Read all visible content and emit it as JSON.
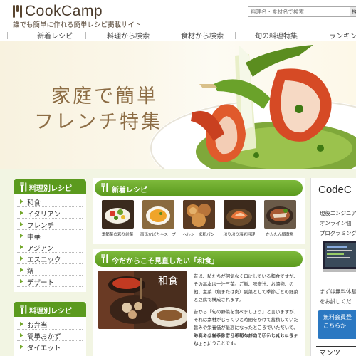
{
  "header": {
    "logo_text": "CookCamp",
    "tagline": "誰でも簡単に作れる簡単レシピ掲載サイト",
    "search_placeholder": "料理名・食材名で検索",
    "search_button": "検"
  },
  "nav": {
    "items": [
      {
        "label": "新着レシピ"
      },
      {
        "label": "料理から検索"
      },
      {
        "label": "食材から検索"
      },
      {
        "label": "旬の料理特集"
      },
      {
        "label": "ランキン"
      }
    ]
  },
  "hero": {
    "line1": "家庭で簡単",
    "line2": "フレンチ特集"
  },
  "sidebar": {
    "box1": {
      "title": "料理別レシピ",
      "items": [
        "和食",
        "イタリアン",
        "フレンチ",
        "中華",
        "アジアン",
        "エスニック",
        "鍋",
        "デザート"
      ]
    },
    "box2": {
      "title": "料理別レシピ",
      "items": [
        "お弁当",
        "簡単おかず",
        "ダイエット"
      ]
    }
  },
  "new_recipes": {
    "title": "新着レシピ",
    "items": [
      {
        "caption": "季節菜の彩り前菜"
      },
      {
        "caption": "南瓜かぼちゃスープ"
      },
      {
        "caption": "ヘルシー米粉パン"
      },
      {
        "caption": "ぷりぷり海老料理"
      },
      {
        "caption": "かんたん鯛煮魚"
      }
    ]
  },
  "feature": {
    "title": "今だからこそ見直したい「和食」",
    "image_label": "和食",
    "paragraph1": "昔以、私たちが何気なく口にしている和食ですが、その基本は一汁三菜。ご飯、味噌汁、お漬物、の他、主菜（魚または肉）副菜として季節ごとの野菜と豆腐で構成されます。",
    "paragraph1b": "昔から「旬の野菜を食べましょう」と言いますが、それは素材がじっくりと時間をかけて蓄積していた旨みや栄養価が最高になったところでいただいて、効率よく栄養を取り風邪などの予防をしましょうね、ということです。",
    "paragraph2": "それでは各季節ごとの旬の野菜について見ていきましょう。"
  },
  "ad": {
    "title": "CodeC",
    "line1": "現役エンジニア",
    "line2": "オンライン個",
    "line3": "プログラミング",
    "line4": "まずは無料体験",
    "line5": "をお試しくだ",
    "button_line1": "無料会員登",
    "button_line2": "こちらか",
    "bottom_text": "マンツ"
  },
  "colors": {
    "accent_green": "#5b9a1e",
    "background": "#f2f5e3",
    "hero_text": "#8c6c44",
    "ad_button": "#2b78c2"
  }
}
